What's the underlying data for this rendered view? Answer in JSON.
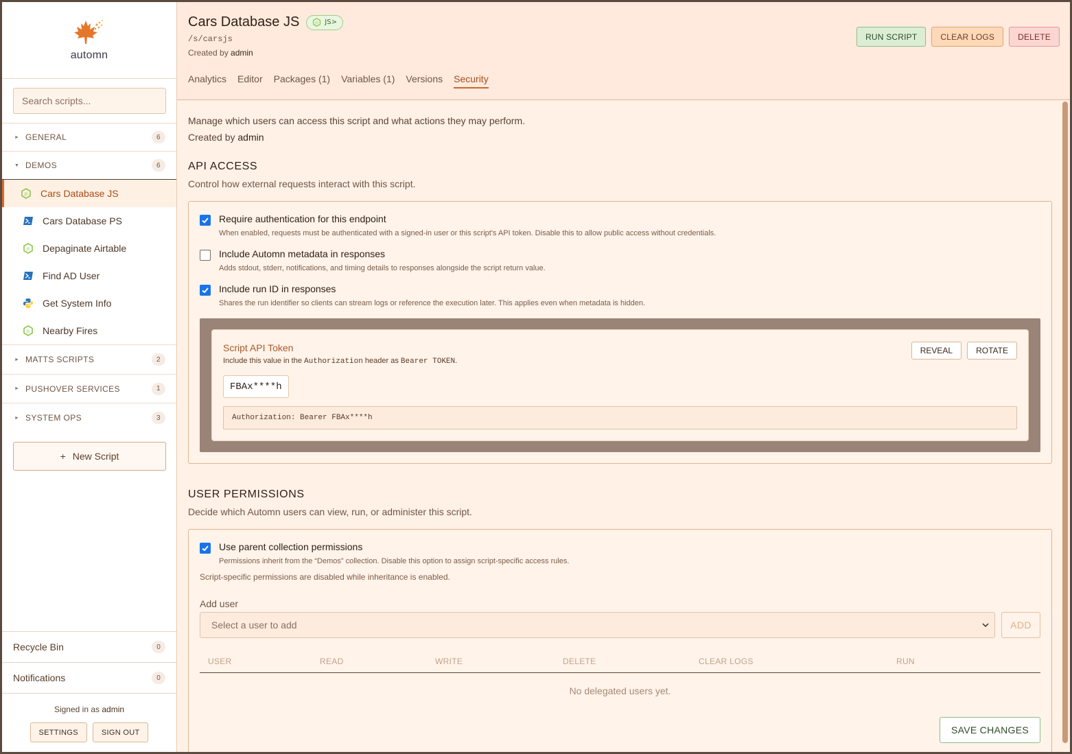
{
  "brand": {
    "name": "automn",
    "accent": "#d86a2a"
  },
  "sidebar": {
    "search_placeholder": "Search scripts...",
    "categories": [
      {
        "label": "GENERAL",
        "count": "6",
        "open": false
      },
      {
        "label": "DEMOS",
        "count": "6",
        "open": true
      },
      {
        "label": "MATTS SCRIPTS",
        "count": "2",
        "open": false
      },
      {
        "label": "PUSHOVER SERVICES",
        "count": "1",
        "open": false
      },
      {
        "label": "SYSTEM OPS",
        "count": "3",
        "open": false
      }
    ],
    "demo_items": [
      {
        "label": "Cars Database JS",
        "icon": "node-icon",
        "active": true
      },
      {
        "label": "Cars Database PS",
        "icon": "powershell-icon"
      },
      {
        "label": "Depaginate Airtable",
        "icon": "node-icon"
      },
      {
        "label": "Find AD User",
        "icon": "powershell-icon"
      },
      {
        "label": "Get System Info",
        "icon": "python-icon"
      },
      {
        "label": "Nearby Fires",
        "icon": "node-icon"
      }
    ],
    "new_script": "New Script",
    "new_script_plus": "+",
    "recycle_bin": {
      "label": "Recycle Bin",
      "count": "0"
    },
    "notifications": {
      "label": "Notifications",
      "count": "0"
    },
    "signed_in_prefix": "Signed in as",
    "signed_in_user": "admin",
    "settings_btn": "SETTINGS",
    "signout_btn": "SIGN OUT"
  },
  "header": {
    "title": "Cars Database JS",
    "badge": "JS>",
    "path": "/s/carsjs",
    "created_prefix": "Created by",
    "created_user": "admin",
    "run_btn": "RUN SCRIPT",
    "clear_btn": "CLEAR LOGS",
    "delete_btn": "DELETE",
    "tabs": [
      "Analytics",
      "Editor",
      "Packages (1)",
      "Variables (1)",
      "Versions",
      "Security"
    ],
    "active_tab": "Security"
  },
  "security": {
    "intro": "Manage which users can access this script and what actions they may perform.",
    "created_prefix": "Created by",
    "created_user": "admin",
    "api": {
      "title": "API ACCESS",
      "desc": "Control how external requests interact with this script.",
      "options": [
        {
          "label": "Require authentication for this endpoint",
          "desc": "When enabled, requests must be authenticated with a signed-in user or this script's API token. Disable this to allow public access without credentials.",
          "checked": true
        },
        {
          "label": "Include Automn metadata in responses",
          "desc": "Adds stdout, stderr, notifications, and timing details to responses alongside the script return value.",
          "checked": false
        },
        {
          "label": "Include run ID in responses",
          "desc": "Shares the run identifier so clients can stream logs or reference the execution later. This applies even when metadata is hidden.",
          "checked": true
        }
      ],
      "token": {
        "title": "Script API Token",
        "desc_1": "Include this value in the",
        "desc_code_1": "Authorization",
        "desc_2": "header as",
        "desc_code_2": "Bearer TOKEN",
        "desc_3": ".",
        "reveal_btn": "REVEAL",
        "rotate_btn": "ROTATE",
        "value": "FBAx****h",
        "auth_line": "Authorization: Bearer FBAx****h"
      }
    },
    "users": {
      "title": "USER PERMISSIONS",
      "desc": "Decide which Automn users can view, run, or administer this script.",
      "inherit_label": "Use parent collection permissions",
      "inherit_desc": "Permissions inherit from the “Demos” collection. Disable this option to assign script-specific access rules.",
      "inherit_checked": true,
      "note": "Script-specific permissions are disabled while inheritance is enabled.",
      "add_label": "Add user",
      "select_placeholder": "Select a user to add",
      "add_btn": "ADD",
      "columns": [
        "USER",
        "READ",
        "WRITE",
        "DELETE",
        "CLEAR LOGS",
        "RUN"
      ],
      "empty": "No delegated users yet.",
      "save_btn": "SAVE CHANGES"
    }
  }
}
